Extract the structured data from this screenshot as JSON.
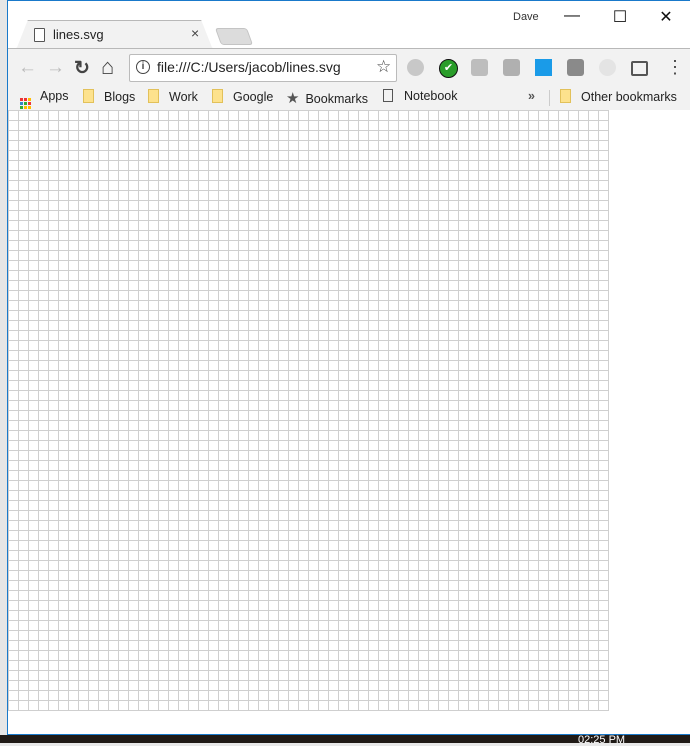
{
  "window": {
    "user": "Dave",
    "minimize": "—",
    "maximize": "☐",
    "close": "✕"
  },
  "tab": {
    "title": "lines.svg",
    "close": "×"
  },
  "toolbar": {
    "back": "←",
    "forward": "→",
    "reload": "↻",
    "home": "⌂",
    "url": "file:///C:/Users/jacob/lines.svg",
    "info": "i",
    "star": "☆",
    "menu": "⋮"
  },
  "extensions": [
    {
      "name": "camera-extension",
      "color": "#c8c8c8"
    },
    {
      "name": "check-extension",
      "color": "#2a9d2a"
    },
    {
      "name": "add-comment-extension",
      "color": "#bdbdbd"
    },
    {
      "name": "image-extension",
      "color": "#b0b0b0"
    },
    {
      "name": "blue-window-extension",
      "color": "#1a9be8"
    },
    {
      "name": "gray-shield-extension",
      "color": "#8a8a8a"
    },
    {
      "name": "swirl-extension",
      "color": "#dddddd"
    }
  ],
  "bookmarks": {
    "apps": "Apps",
    "items": [
      "Blogs",
      "Work",
      "Google",
      "Bookmarks",
      "Notebook"
    ],
    "overflow": "»",
    "other": "Other bookmarks"
  },
  "content": {
    "grid_spacing_units": 10,
    "grid_color": "#cfcfcf"
  },
  "taskbar": {
    "time": "02:25 PM"
  }
}
